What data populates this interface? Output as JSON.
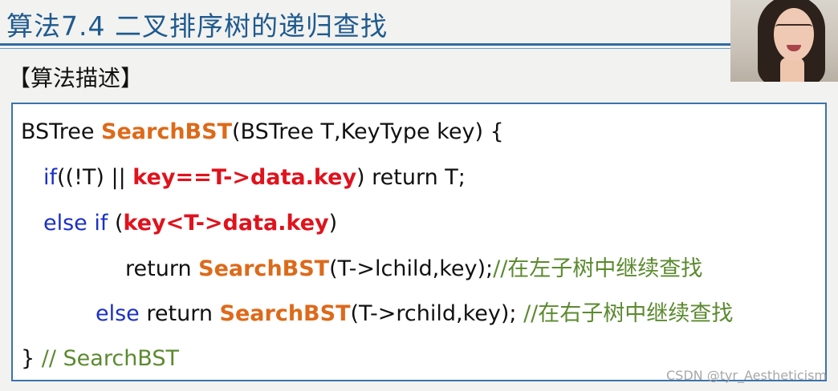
{
  "slide": {
    "title": "算法7.4  二叉排序树的递归查找",
    "section_heading": "【算法描述】"
  },
  "code": {
    "line1": {
      "t1": "BSTree ",
      "fn": "SearchBST",
      "t2": "(BSTree T,KeyType key) {"
    },
    "line2": {
      "kw": "if",
      "t1": "((!T) || ",
      "red": "key==T->data.key",
      "t2": ") return T;"
    },
    "line3": {
      "kw": "else if",
      "t1": " (",
      "red": "key<T->data.key",
      "t2": ")"
    },
    "line4": {
      "t1": "return ",
      "fn": "SearchBST",
      "t2": "(T->lchild,key);",
      "cmt": "//在左子树中继续查找"
    },
    "line5": {
      "kw": "else",
      "t1": " return ",
      "fn": "SearchBST",
      "t2": "(T->rchild,key); ",
      "cmt": "//在右子树中继续查找"
    },
    "line6": {
      "t1": "} ",
      "cmt": "// SearchBST"
    }
  },
  "watermark": "CSDN @tyr_Aestheticism",
  "colors": {
    "title": "#1f5a8e",
    "keyword": "#1b30c4",
    "function": "#dd6a1a",
    "condition": "#e0121c",
    "comment": "#5b8a2f",
    "box_border": "#3b73ad"
  }
}
